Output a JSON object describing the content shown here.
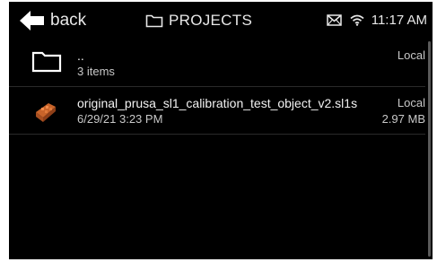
{
  "header": {
    "back_label": "back",
    "title": "PROJECTS",
    "time": "11:17 AM",
    "icons": {
      "back": "arrow-left-icon",
      "title": "folder-icon",
      "mail": "mail-icon",
      "wifi": "wifi-icon"
    }
  },
  "files": [
    {
      "name": "..",
      "details": "3 items",
      "location": "Local",
      "size": "",
      "icon": "folder-icon"
    },
    {
      "name": "original_prusa_sl1_calibration_test_object_v2.sl1s",
      "details": "6/29/21 3:23 PM",
      "location": "Local",
      "size": "2.97 MB",
      "icon": "print-thumbnail-icon"
    }
  ],
  "colors": {
    "background": "#000000",
    "text": "#e8e8e8",
    "thumbnail": "#c8642a"
  }
}
